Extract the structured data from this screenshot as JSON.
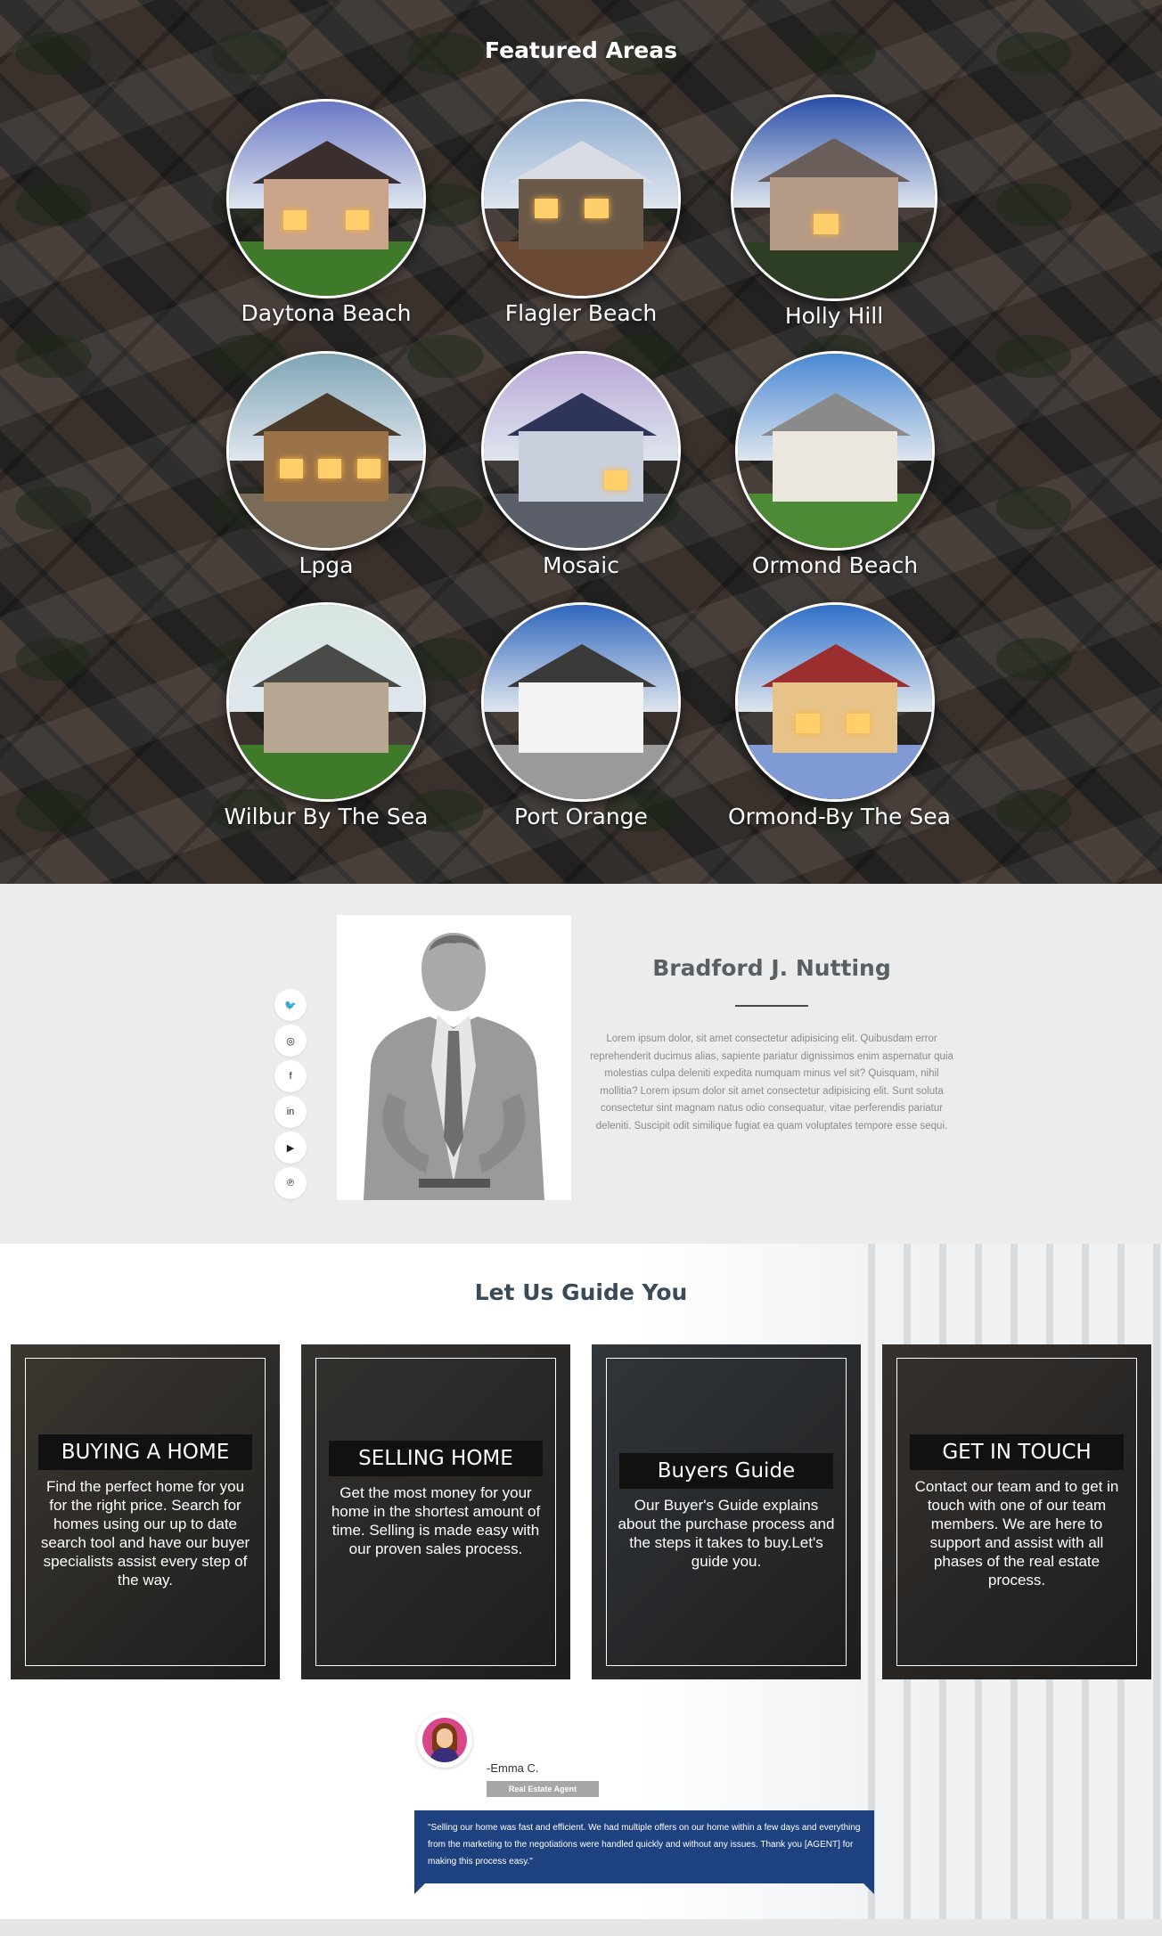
{
  "featured": {
    "title": "Featured Areas",
    "areas": [
      {
        "label": "Daytona Beach",
        "sky": "#6b78c6",
        "house": "#c9a48a",
        "roof": "#3a2e2e",
        "ground": "#3f7a2a"
      },
      {
        "label": "Flagler Beach",
        "sky": "#8aa9cf",
        "house": "#6b5a4a",
        "roof": "#d8dde3",
        "ground": "#6a4a34"
      },
      {
        "label": "Holly Hill",
        "sky": "#2a4ea8",
        "house": "#b59a86",
        "roof": "#6a5e5a",
        "ground": "#2e3e24"
      },
      {
        "label": "Lpga",
        "sky": "#7fa5b5",
        "house": "#9a7248",
        "roof": "#4a3a2a",
        "ground": "#7a6a58"
      },
      {
        "label": "Mosaic",
        "sky": "#b8a6d6",
        "house": "#c9d0dd",
        "roof": "#2e3558",
        "ground": "#5a5f6a"
      },
      {
        "label": "Ormond Beach",
        "sky": "#4a88d4",
        "house": "#ebe6de",
        "roof": "#8a8a8a",
        "ground": "#4c8a36"
      },
      {
        "label": "Wilbur By The Sea",
        "sky": "#d8e6e0",
        "house": "#b6a692",
        "roof": "#4a4a48",
        "ground": "#3f7a2a"
      },
      {
        "label": "Port Orange",
        "sky": "#2f66bd",
        "house": "#f3f3f3",
        "roof": "#3a3a3a",
        "ground": "#9a9a9a"
      },
      {
        "label": "Ormond-By The Sea",
        "sky": "#2f6fc9",
        "house": "#e7c38a",
        "roof": "#9b2e2e",
        "ground": "#7f9ad4"
      }
    ]
  },
  "agent": {
    "name": "Bradford J. Nutting",
    "bio": "Lorem ipsum dolor, sit amet consectetur adipisicing elit. Quibusdam error reprehenderit ducimus alias, sapiente pariatur dignissimos enim aspernatur quia molestias culpa deleniti expedita numquam minus vel sit? Quisquam, nihil mollitia? Lorem ipsum dolor sit amet consectetur adipisicing elit. Sunt soluta consectetur sint magnam natus odio consequatur, vitae perferendis pariatur deleniti. Suscipit odit similique fugiat ea quam voluptates tempore esse sequi.",
    "socials": [
      {
        "icon": "twitter-icon",
        "glyph": "🐦"
      },
      {
        "icon": "instagram-icon",
        "glyph": "◎"
      },
      {
        "icon": "facebook-icon",
        "glyph": "f"
      },
      {
        "icon": "linkedin-icon",
        "glyph": "in"
      },
      {
        "icon": "youtube-icon",
        "glyph": "▶"
      },
      {
        "icon": "pinterest-icon",
        "glyph": "℗"
      }
    ]
  },
  "guide": {
    "title": "Let Us Guide You",
    "cards": [
      {
        "title": "BUYING A HOME",
        "text": "Find the perfect home for you for the right price. Search for homes using our up to date search tool and have our buyer specialists assist every step of the way.",
        "color": "#6c6152"
      },
      {
        "title": "SELLING HOME",
        "text": "Get the most money for your home in the shortest amount of time. Selling is made easy with our proven sales process.",
        "color": "#5a5650"
      },
      {
        "title": "Buyers Guide",
        "text": "Our Buyer's Guide explains about the purchase process and the steps it takes to buy.Let's guide you.",
        "color": "#55606b"
      },
      {
        "title": "GET IN TOUCH",
        "text": "Contact our team and to get in touch with one of our team members. We are here to support and assist with all phases of the real estate process.",
        "color": "#5e544c"
      }
    ]
  },
  "testimonial": {
    "name": "-Emma C.",
    "role": "Real Estate Agent",
    "quote": "\"Selling our home was fast and efficient. We had multiple offers on our home within a few days and everything from the marketing to the negotiations were handled quickly and without any issues. Thank you [AGENT] for making this process easy.\""
  }
}
